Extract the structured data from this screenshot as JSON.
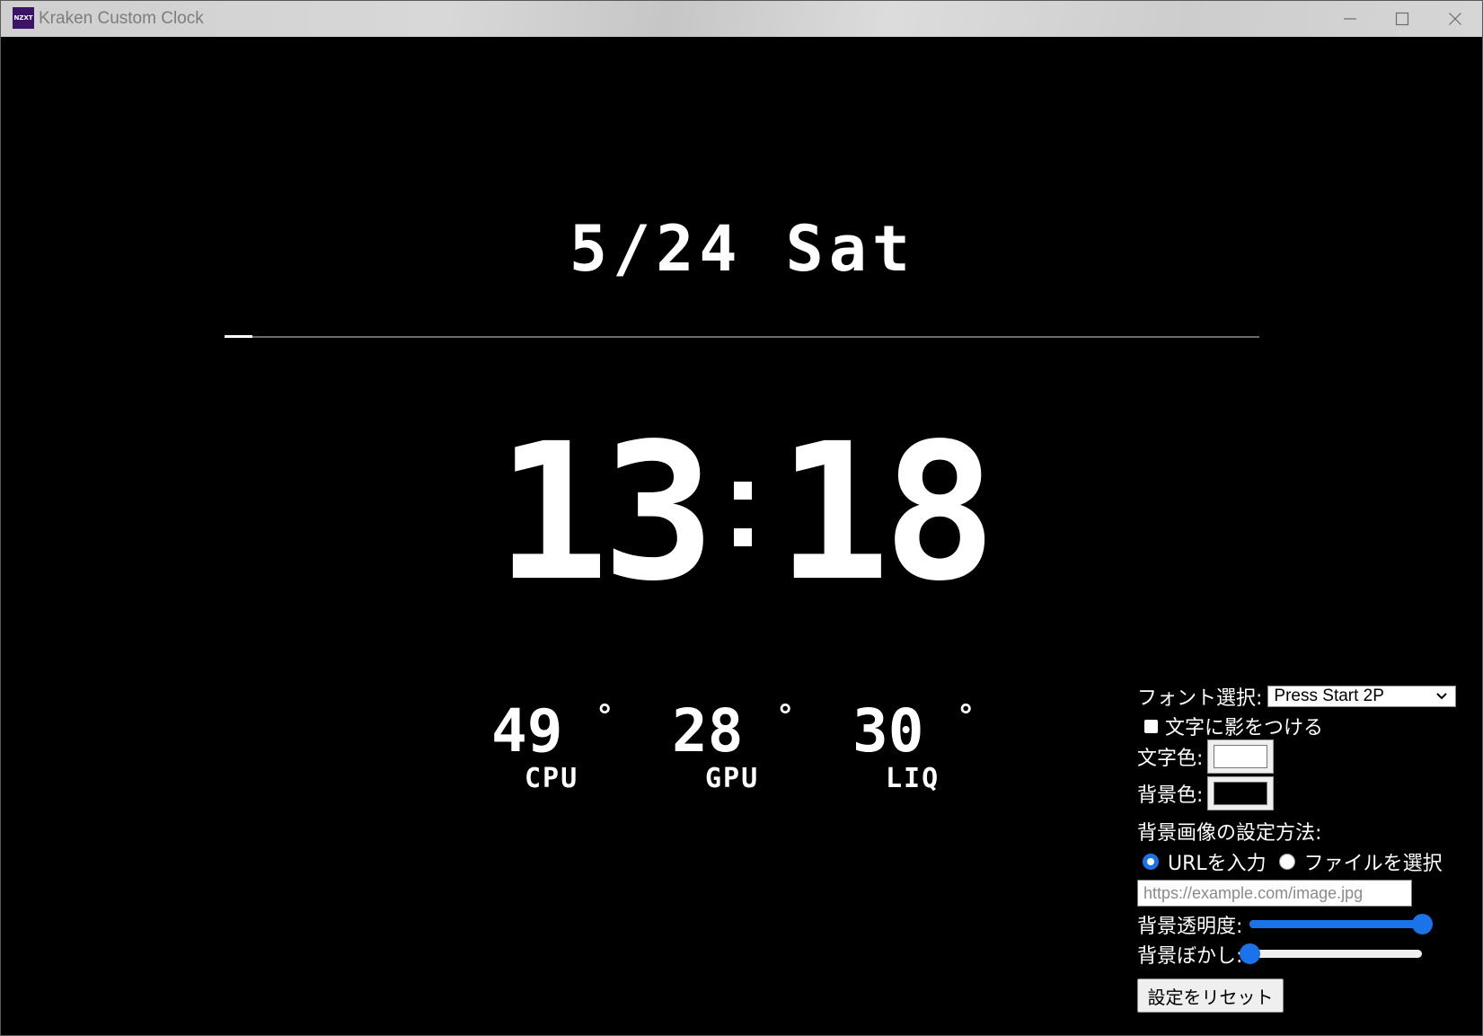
{
  "window": {
    "title": "Kraken Custom Clock",
    "app_icon_text": "NZXT"
  },
  "clock": {
    "date": "5/24 Sat",
    "hours": "13",
    "minutes": "18",
    "day_progress_fraction": 0.027
  },
  "temps": [
    {
      "value": "49",
      "degree": "°",
      "label": "CPU"
    },
    {
      "value": "28",
      "degree": "°",
      "label": "GPU"
    },
    {
      "value": "30",
      "degree": "°",
      "label": "LIQ"
    }
  ],
  "settings": {
    "font_label": "フォント選択:",
    "font_value": "Press Start 2P",
    "shadow_label": "文字に影をつける",
    "shadow_checked": false,
    "text_color_label": "文字色:",
    "text_color": "#ffffff",
    "bg_color_label": "背景色:",
    "bg_color": "#000000",
    "bg_image_method_label": "背景画像の設定方法:",
    "radio_url_label": "URLを入力",
    "radio_file_label": "ファイルを選択",
    "url_placeholder": "https://example.com/image.jpg",
    "opacity_label": "背景透明度:",
    "opacity_value": 1.0,
    "blur_label": "背景ぼかし:",
    "blur_value": 0.0,
    "reset_label": "設定をリセット"
  },
  "colors": {
    "accent": "#1a73e8",
    "app_icon_bg": "#3b1466"
  },
  "icons": {
    "minimize": "minimize-icon",
    "maximize": "maximize-icon",
    "close": "close-icon",
    "dropdown": "chevron-down-icon"
  }
}
